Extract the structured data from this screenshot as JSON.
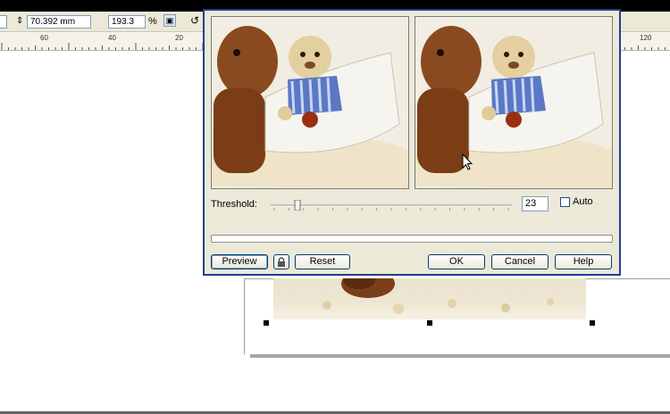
{
  "propbar": {
    "size_value": "70.392 mm",
    "zoom_value": "193.3",
    "percent_label": "%"
  },
  "ruler": {
    "ticks": [
      "60",
      "40",
      "20",
      "120"
    ]
  },
  "dialog": {
    "threshold_label": "Threshold:",
    "threshold_value": "23",
    "threshold_fraction": 0.09,
    "auto_label": "Auto",
    "auto_checked": false,
    "buttons": {
      "preview": "Preview",
      "reset": "Reset",
      "ok": "OK",
      "cancel": "Cancel",
      "help": "Help"
    }
  },
  "colors": {
    "dialog_border": "#1f3f93",
    "dialog_bg": "#ece9d8",
    "button_border": "#003c74"
  },
  "icons": {
    "lock": "lock-icon",
    "cursor": "mouse-pointer-icon"
  }
}
